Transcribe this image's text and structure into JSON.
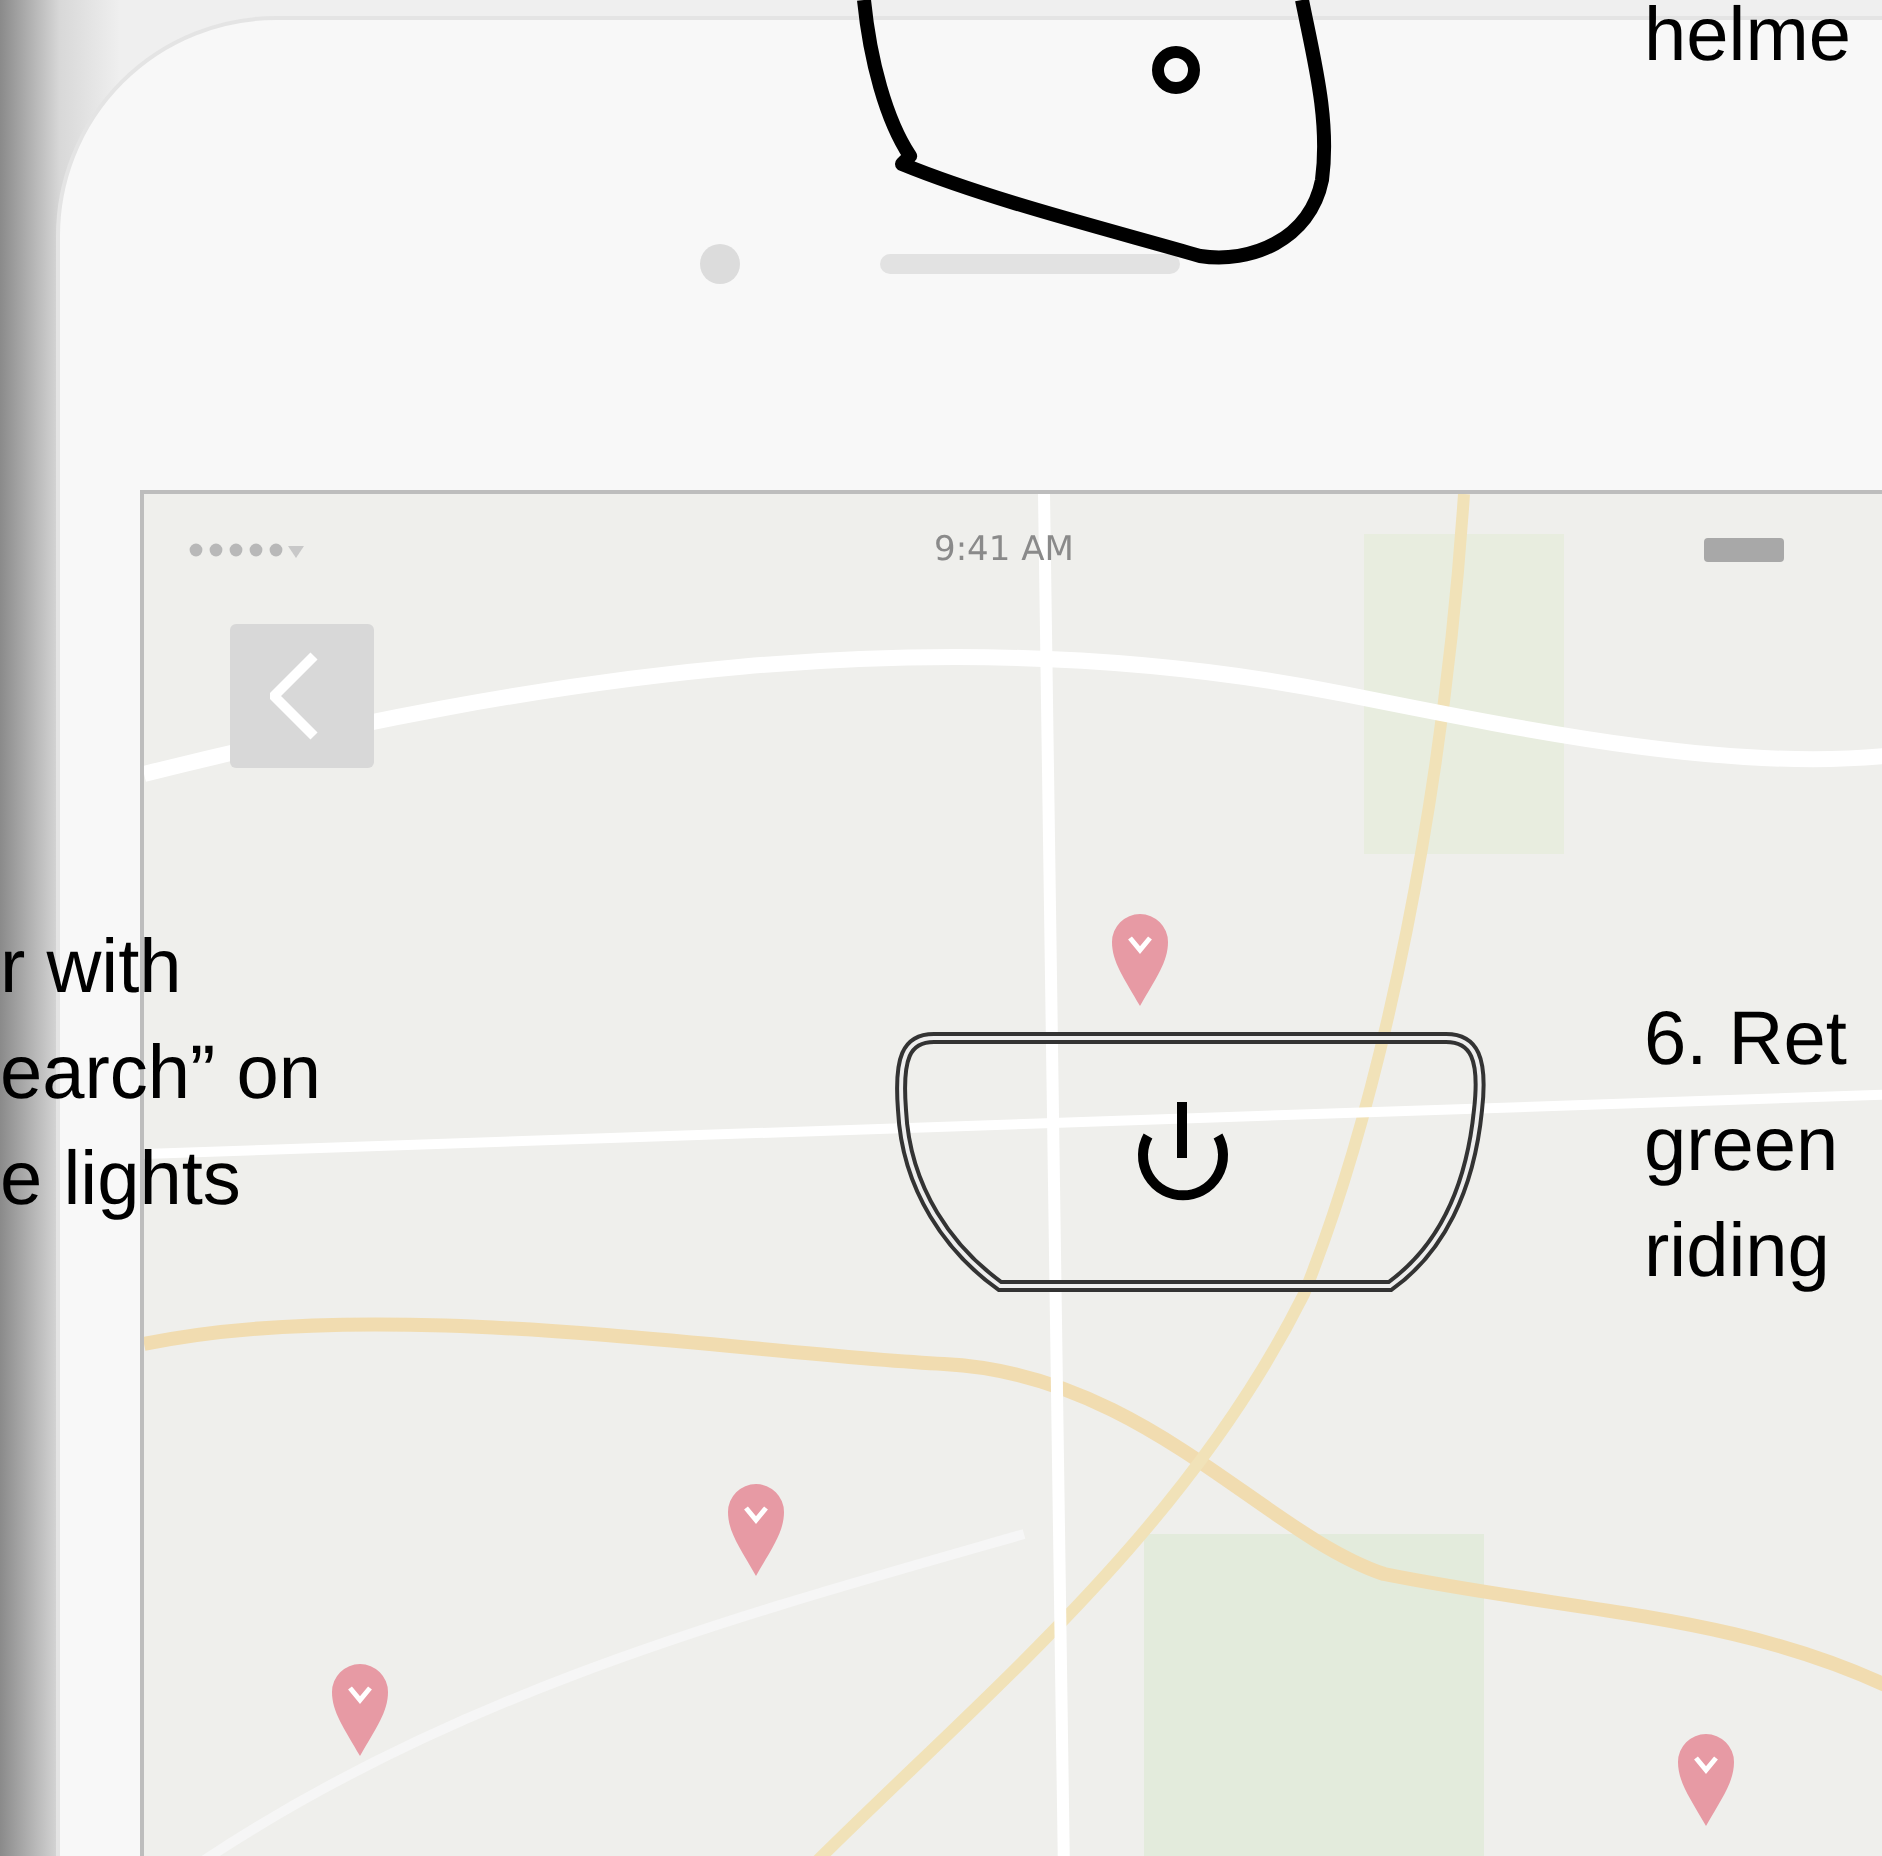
{
  "annotations": [
    {
      "kind": "top",
      "text": "helme"
    },
    {
      "kind": "left",
      "text": "r with\nearch” on\ne lights"
    },
    {
      "kind": "right",
      "text": "6. Ret\ngreen\nriding"
    }
  ],
  "status_bar": {
    "time": "9:41 AM"
  }
}
